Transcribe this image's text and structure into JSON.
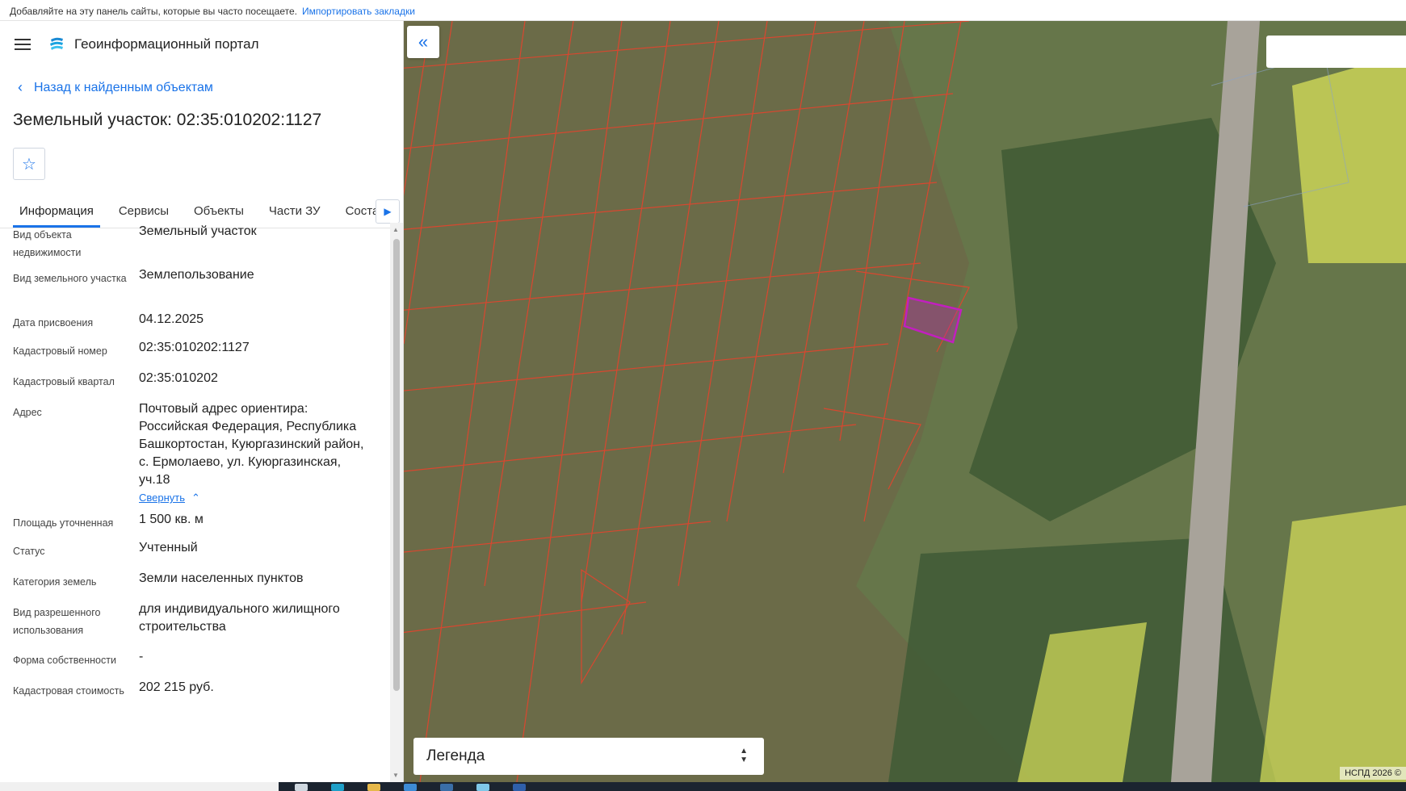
{
  "bookmarks_bar": {
    "text": "Добавляйте на эту панель сайты, которые вы часто посещаете.",
    "link": "Импортировать закладки"
  },
  "header": {
    "title": "Геоинформационный портал"
  },
  "back_link": "Назад к найденным объектам",
  "object_title": "Земельный участок: 02:35:010202:1127",
  "tabs": [
    "Информация",
    "Сервисы",
    "Объекты",
    "Части ЗУ",
    "Состав"
  ],
  "active_tab": "Информация",
  "info": {
    "rows": [
      {
        "key": "Вид объекта недвижимости",
        "value": "Земельный участок"
      },
      {
        "key": "Вид земельного участка",
        "value": "Землепользование"
      },
      {
        "key": "Дата присвоения",
        "value": "04.12.2025"
      },
      {
        "key": "Кадастровый номер",
        "value": "02:35:010202:1127"
      },
      {
        "key": "Кадастровый квартал",
        "value": "02:35:010202"
      },
      {
        "key": "Адрес",
        "value": "Почтовый адрес ориентира: Российская Федерация, Республика Башкортостан, Куюргазинский район, с. Ермолаево, ул. Куюргазинская, уч.18"
      },
      {
        "key": "Площадь уточненная",
        "value": "1 500 кв. м"
      },
      {
        "key": "Статус",
        "value": "Учтенный"
      },
      {
        "key": "Категория земель",
        "value": "Земли населенных пунктов"
      },
      {
        "key": "Вид разрешенного использования",
        "value": "для индивидуального жилищного строительства"
      },
      {
        "key": "Форма собственности",
        "value": "-"
      },
      {
        "key": "Кадастровая стоимость",
        "value": "202 215 руб."
      }
    ],
    "collapse_label": "Свернуть"
  },
  "map": {
    "legend_label": "Легенда",
    "attribution": "НСПД 2026 ©",
    "colors": {
      "parcel_outline": "#d9472f",
      "selected_parcel": "#c21fbf",
      "field_highlight": "#d8e05a"
    }
  }
}
